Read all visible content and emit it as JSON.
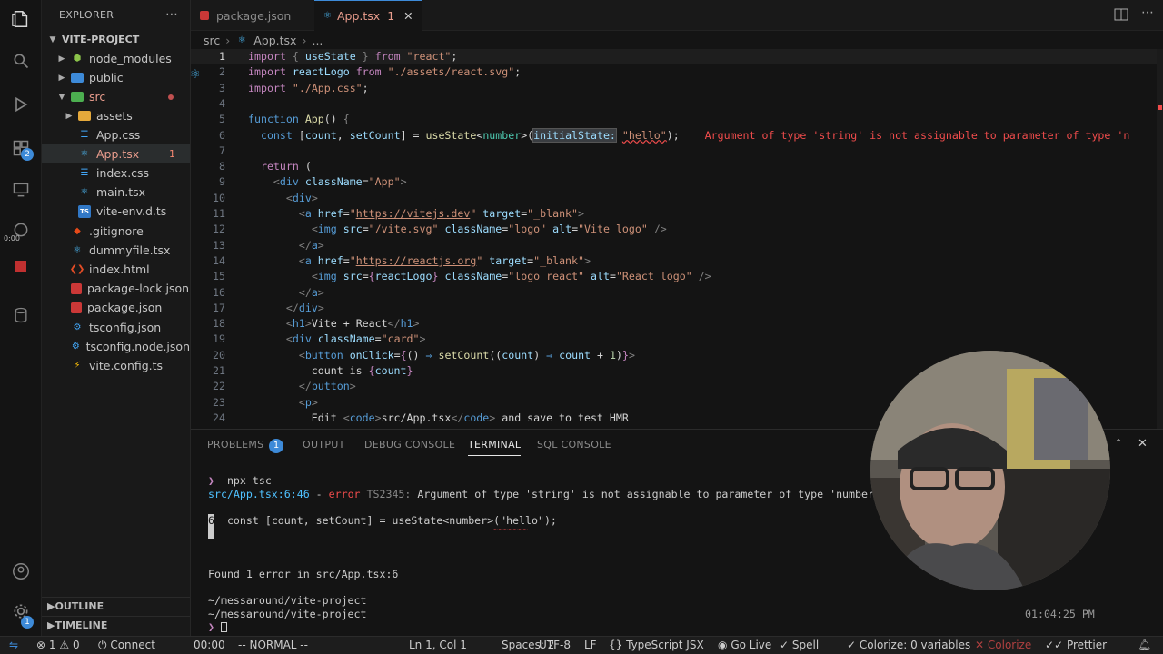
{
  "sidebar": {
    "title": "EXPLORER",
    "project": "VITE-PROJECT",
    "items": [
      {
        "label": "node_modules"
      },
      {
        "label": "public"
      },
      {
        "label": "src"
      },
      {
        "label": "assets"
      },
      {
        "label": "App.css"
      },
      {
        "label": "App.tsx",
        "count": "1"
      },
      {
        "label": "index.css"
      },
      {
        "label": "main.tsx"
      },
      {
        "label": "vite-env.d.ts"
      },
      {
        "label": ".gitignore"
      },
      {
        "label": "dummyfile.tsx"
      },
      {
        "label": "index.html"
      },
      {
        "label": "package-lock.json"
      },
      {
        "label": "package.json"
      },
      {
        "label": "tsconfig.json"
      },
      {
        "label": "tsconfig.node.json"
      },
      {
        "label": "vite.config.ts"
      }
    ],
    "outline": "OUTLINE",
    "timeline": "TIMELINE",
    "timer": "0:00"
  },
  "activity": {
    "source_control_badge": "2",
    "accounts_badge": "1"
  },
  "tabs": [
    {
      "label": "package.json"
    },
    {
      "label": "App.tsx",
      "count": "1"
    }
  ],
  "breadcrumb": {
    "folder": "src",
    "file": "App.tsx",
    "more": "..."
  },
  "editor": {
    "lines": [
      "1",
      "2",
      "3",
      "4",
      "5",
      "6",
      "7",
      "8",
      "9",
      "10",
      "11",
      "12",
      "13",
      "14",
      "15",
      "16",
      "17",
      "18",
      "19",
      "20",
      "21",
      "22",
      "23",
      "24"
    ],
    "inline_error": "Argument of type 'string' is not assignable to parameter of type 'n"
  },
  "panel": {
    "tabs": [
      "PROBLEMS",
      "OUTPUT",
      "DEBUG CONSOLE",
      "TERMINAL",
      "SQL CONSOLE"
    ],
    "problems_count": "1",
    "terminal": {
      "prompt_cmd": "npx tsc",
      "error_loc": "src/App.tsx:6:46",
      "error_sep": " - ",
      "error_word": "error",
      "error_code": "TS2345:",
      "error_msg": "Argument of type 'string' is not assignable to parameter of type 'number | (() ",
      "gutter_num": "6",
      "code_line": "const [count, setCount] = useState<number>(\"hello\");",
      "squiggle": "~~~~~~~",
      "found": "Found 1 error in src/App.tsx:6",
      "path1": "~/messaround/vite-project",
      "path2": "~/messaround/vite-project",
      "time": "01:04:25 PM"
    }
  },
  "status": {
    "errors": "1",
    "warnings": "0",
    "connect": "Connect",
    "time": "00:00",
    "mode": "-- NORMAL --",
    "position": "Ln 1, Col 1",
    "spaces": "Spaces: 2",
    "encoding": "UTF-8",
    "eol": "LF",
    "language": "TypeScript JSX",
    "golive": "Go Live",
    "spell": "Spell",
    "colorize": "Colorize: 0 variables",
    "colorize2": "Colorize",
    "prettier": "Prettier"
  },
  "colors": {
    "accent": "#3d8ad8",
    "error": "#f14c4c",
    "status_bg": "#1d1d1d"
  }
}
